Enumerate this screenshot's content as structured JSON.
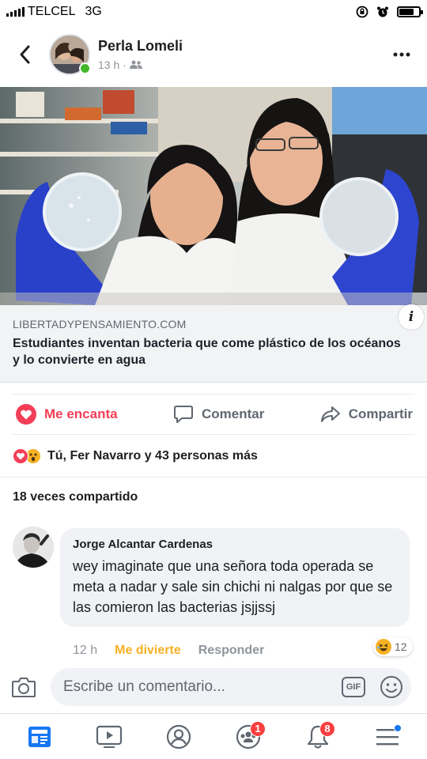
{
  "status_bar": {
    "carrier": "TELCEL",
    "network": "3G",
    "battery_level": 0.75
  },
  "post": {
    "author": "Perla Lomeli",
    "time": "13 h",
    "audience_icon": "friends-icon",
    "more_icon": "more-horizontal-icon",
    "back_icon": "chevron-left-icon"
  },
  "link_preview": {
    "domain": "LIBERTADYPENSAMIENTO.COM",
    "title": "Estudiantes inventan bacteria que come plástico de los océanos y lo convierte en agua",
    "info_label": "i"
  },
  "actions": {
    "love_label": "Me encanta",
    "comment_label": "Comentar",
    "share_label": "Compartir",
    "love_color": "#f33e58"
  },
  "reactions": {
    "summary": "Tú, Fer Navarro y 43 personas más",
    "icons": [
      "love-reaction-icon",
      "wow-reaction-icon"
    ]
  },
  "shares": {
    "text": "18 veces compartido"
  },
  "comment": {
    "author": "Jorge Alcantar Cardenas",
    "text": "wey imaginate que una señora toda operada se meta a nadar y sale sin chichi ni nalgas por que se las comieron las bacterias jsjjssj",
    "time": "12 h",
    "reaction_label": "Me divierte",
    "reply_label": "Responder",
    "reaction_count": "12"
  },
  "composer": {
    "placeholder": "Escribe un comentario...",
    "gif_label": "GIF"
  },
  "bottom_nav": {
    "items": [
      {
        "name": "news-feed-icon",
        "badge": ""
      },
      {
        "name": "watch-icon",
        "badge": ""
      },
      {
        "name": "profile-icon",
        "badge": ""
      },
      {
        "name": "groups-icon",
        "badge": "1"
      },
      {
        "name": "notifications-icon",
        "badge": "8"
      },
      {
        "name": "menu-icon",
        "badge": ""
      }
    ]
  },
  "colors": {
    "facebook_blue": "#1877f2",
    "badge_red": "#fa3e3e",
    "online_green": "#42b72a",
    "haha_yellow": "#f7b125"
  }
}
